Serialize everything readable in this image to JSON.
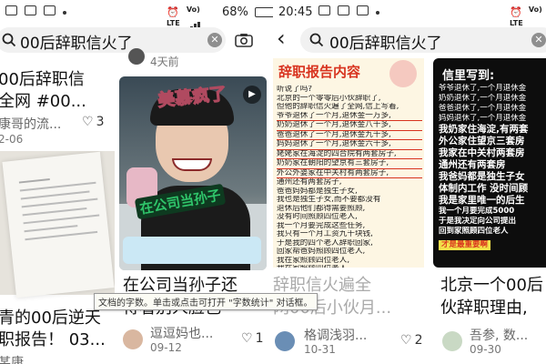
{
  "left_screen": {
    "status": {
      "battery": "68%"
    },
    "search": {
      "query": "00后辞职信火了"
    },
    "top_meta": "4天前",
    "card_a": {
      "title_line1": "00后辞职信",
      "title_line2": "全网 #00...",
      "author": "康哥的流...",
      "likes": "3",
      "date": "2-06"
    },
    "card_video": {
      "sticker_text1": "美慕疯了",
      "sticker_text2": "在公司当孙子",
      "title_line1": "在公司当孙子还",
      "title_line2": "得看别人脸色",
      "author": "逗逗妈也...",
      "date": "09-12",
      "likes": "1"
    },
    "card_doc": {
      "title_line1": "青的00后逆天",
      "title_line2": "职报告！ 03...",
      "author": "某康"
    }
  },
  "right_screen": {
    "status": {
      "time": "20:45"
    },
    "search": {
      "query": "00后辞职信火了"
    },
    "card_report": {
      "header": "辞职报告内容",
      "lines": [
        "听说了吗?",
        "北京的一个零零后小伙辞职了,",
        "但他的辞职信火遍了全网,信上写着,",
        "爷爷退休了一个月,退休金一万多,",
        "奶奶退休了一个月,退休金八千多,",
        "爸爸退休了一个月,退休金九千多,",
        "妈妈退休了一个月,退休金六千多,",
        "姥姥家在海淀的四合院有两套房子,",
        "奶奶家在朝阳的望京有三套房子,",
        "外公外婆家在中关村有两套房子,",
        "通州还有两套房子,",
        "爸爸妈妈都是独生子女,",
        "我也是独生子女,而不要都没有",
        "退休后他们都得需要照顾,",
        "没有时间照顾四位老人,",
        "我一个月要完成这些任务,",
        "我只有一个月工资九千块钱,",
        "于是我的四个老人辞职回家,",
        "回家帮爸妈照顾四位老人,",
        "我在家照顾四位老人,",
        "我在家照顾四位老人"
      ],
      "title_line1": "辞职信火遍全",
      "title_line2": "网00后小伙月...",
      "author": "格调浅羽...",
      "date": "10-31",
      "likes": "2"
    },
    "card_letter": {
      "header": "信里写到:",
      "lines": [
        "爷爷退休了,一个月退休金",
        "奶奶退休了,一个月退休金",
        "爸爸退休了,一个月退休金",
        "妈妈退休了,一个月退休金",
        "我奶家住海淀,有两套",
        "外公家住望京三套房",
        "我家在中关村两套房",
        "通州还有两套房",
        "我爸妈都是独生子女",
        "体制内工作 没时间顾",
        "我是家里唯一的后生",
        "我一个月要完成5000",
        "于是我决定向公司提出",
        "回到家照顾四位老人",
        "才是最重要啊"
      ],
      "title_line1": "北京一个00后",
      "title_line2": "伙辞职理由,",
      "author": "吾参, 数...",
      "date": "09-30"
    }
  },
  "tooltip": "文档的字数。单击或点击可打开 \"字数统计\" 对话框。",
  "colors": {
    "search_bg": "#f1f1f1",
    "video_bg_top": "#3a4a55",
    "sticker_green": "#2fc46a",
    "sticker_pink": "#f2a5b3",
    "cream_bg": "#fdf6e3",
    "red_text": "#d8331f",
    "black_bg": "#0d0d0d",
    "yellow_text": "#f5e14a"
  }
}
